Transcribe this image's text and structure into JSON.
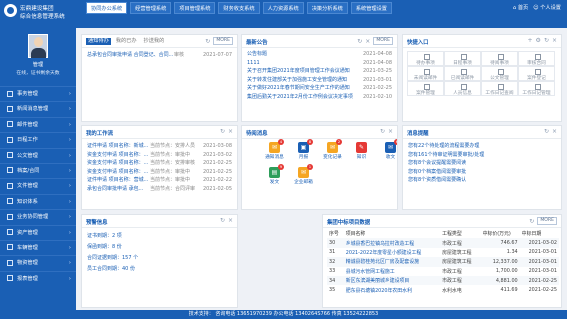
{
  "app": {
    "name_line1": "宏鼎建设集团",
    "name_line2": "综合信息管理系统"
  },
  "tabs": [
    {
      "label": "协同办公系统",
      "active": true
    },
    {
      "label": "经营管理系统",
      "active": false
    },
    {
      "label": "项目管理系统",
      "active": false
    },
    {
      "label": "财务收支系统",
      "active": false
    },
    {
      "label": "人力资源系统",
      "active": false
    },
    {
      "label": "决策分析系统",
      "active": false
    },
    {
      "label": "系统管理设置",
      "active": false
    }
  ],
  "topright": {
    "home": "首页",
    "personal": "个人设置"
  },
  "user": {
    "name": "管理",
    "status": "在线，证书剩余天数"
  },
  "menu": [
    "事务管理",
    "新闻消息管理",
    "邮件管理",
    "日程工作",
    "公文管理",
    "档案/合同",
    "文件管理",
    "知识体系",
    "业务协同管理",
    "资产管理",
    "车辆管理",
    "物资管理",
    "报表管理"
  ],
  "notice": {
    "tabs": [
      "通知待办",
      "我的已办",
      "抄送我的"
    ],
    "items": [
      {
        "text": "总承包合同审批申请 合同登记、合同...",
        "mid": "审核",
        "date": "2021-07-07"
      }
    ]
  },
  "latest": {
    "title": "最新公告",
    "more": "MORE",
    "items": [
      {
        "text": "公告标题",
        "date": "2021-04-08"
      },
      {
        "text": "1111",
        "date": "2021-04-08"
      },
      {
        "text": "关于召开集团2021年度项目管理工作会议通知",
        "date": "2021-03-25"
      },
      {
        "text": "关于转发住建部关于加强施工安全管理的通知",
        "date": "2021-03-01"
      },
      {
        "text": "关于做好2021年春节期间安全生产工作的通知",
        "date": "2021-02-25"
      },
      {
        "text": "集团后勤关于2021年2月份工作例会议决定事项",
        "date": "2021-02-10"
      }
    ]
  },
  "quick": {
    "title": "快捷入口",
    "items": [
      "待办事项",
      "日程事项",
      "待阅事项",
      "审核合同",
      "未阅读邮件",
      "已阅读邮件",
      "公文管理",
      "案件登记",
      "案件管理",
      "人员信息",
      "工作日记查阅",
      "工作日记管理"
    ]
  },
  "workflow": {
    "title": "我的工作流",
    "items": [
      {
        "text": "证件申请 项目名称：新城...",
        "mid": "当前节点：安排人员",
        "date": "2021-03-08"
      },
      {
        "text": "资金支付申请 项目名称：...",
        "mid": "当前节点：审批中",
        "date": "2021-03-02"
      },
      {
        "text": "资金支付申请 项目名称：...",
        "mid": "当前节点：安排审核",
        "date": "2021-02-25"
      },
      {
        "text": "资金支付申请 项目名称：...",
        "mid": "当前节点：审批中",
        "date": "2021-02-25"
      },
      {
        "text": "证件申请 项目名称：营城...",
        "mid": "当前节点：审批中",
        "date": "2021-02-22"
      },
      {
        "text": "承包合同审批申请 承包...",
        "mid": "当前节点：合同评审",
        "date": "2021-02-05"
      }
    ]
  },
  "messages": {
    "title": "待阅消息",
    "items": [
      {
        "label": "通知消息",
        "count": "4",
        "color": "#f5a623",
        "glyph": "✉"
      },
      {
        "label": "月报",
        "count": "8",
        "color": "#1a5fb4",
        "glyph": "▣"
      },
      {
        "label": "变化记录",
        "count": "2",
        "color": "#f5a623",
        "glyph": "✉"
      },
      {
        "label": "知识",
        "count": "",
        "color": "#e53935",
        "glyph": "✎"
      },
      {
        "label": "收文",
        "count": "6",
        "color": "#1a5fb4",
        "glyph": "✉"
      },
      {
        "label": "发文",
        "count": "9",
        "color": "#2e9e5b",
        "glyph": "▤"
      },
      {
        "label": "企业邮箱",
        "count": "1",
        "color": "#f5a623",
        "glyph": "✉"
      }
    ]
  },
  "reminder": {
    "title": "消息提醒",
    "items": [
      "您有22个待处理的流程需要办理",
      "您有161个待审证明需要审批/处理",
      "您有8个会议提醒需要阅读",
      "您有0个档案借阅需要审批",
      "您有8个资质借阅需要确认"
    ]
  },
  "status": {
    "title": "预警信息",
    "items": [
      "证书到期：2 项",
      "保函到期：8 份",
      "合同证据到期：157 个",
      "员工合同到期：40 份"
    ]
  },
  "projects": {
    "title": "集团中标项目数据",
    "more": "MORE",
    "headers": [
      "序号",
      "项目名称",
      "工程类型",
      "中标价(万元)",
      "中标日期"
    ],
    "rows": [
      [
        "30",
        "乡城县香巴拉镇乌拉村改造工程",
        "市政工程",
        "746.67",
        "2021-03-02"
      ],
      [
        "31",
        "2021-2022年度零星小额建设工程",
        "房屋建筑工程",
        "1.34",
        "2021-03-01"
      ],
      [
        "32",
        "精诚县碧桂苑北区厂房及配套设施",
        "房屋建筑工程",
        "12,337.00",
        "2021-03-01"
      ],
      [
        "33",
        "县城污水管网工程施工",
        "市政工程",
        "1,700.00",
        "2021-03-01"
      ],
      [
        "34",
        "新区东滨湖美丽城乡建设项目",
        "市政工程",
        "4,881.00",
        "2021-02-25"
      ],
      [
        "35",
        "肥东县石塘镇2020年农田水利",
        "水利水电",
        "411.69",
        "2021-02-25"
      ]
    ]
  },
  "footer": "技术支持：  咨询电话 13651970239 办公电话 1340264S766 传真 13524222853"
}
